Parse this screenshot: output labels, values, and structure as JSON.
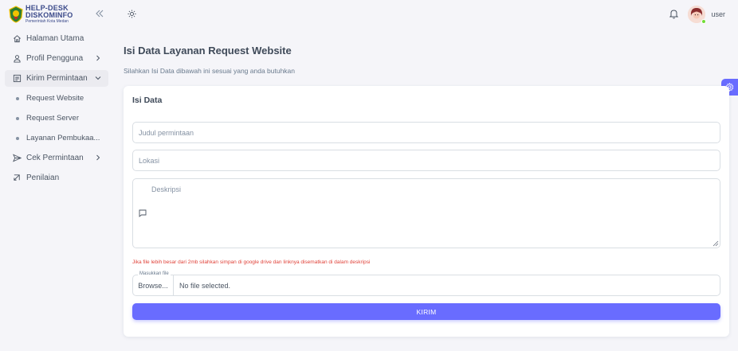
{
  "brand": {
    "line1": "HELP-DESK",
    "line2": "DISKOMINFO",
    "line3": "Pemerintah Kota Medan"
  },
  "sidebar": {
    "items": [
      {
        "label": "Halaman Utama",
        "icon": "home-icon"
      },
      {
        "label": "Profil Pengguna",
        "icon": "user-icon"
      },
      {
        "label": "Kirim Permintaan",
        "icon": "form-icon",
        "active": true,
        "children": [
          {
            "label": "Request Website"
          },
          {
            "label": "Request Server"
          },
          {
            "label": "Layanan Pembukaa..."
          }
        ]
      },
      {
        "label": "Cek Permintaan",
        "icon": "send-icon"
      },
      {
        "label": "Penilaian",
        "icon": "rating-icon"
      }
    ]
  },
  "header": {
    "username": "user"
  },
  "page": {
    "title": "Isi Data Layanan Request Website",
    "subtitle": "Silahkan Isi Data dibawah ini sesuai yang anda butuhkan"
  },
  "form": {
    "card_title": "Isi Data",
    "judul_placeholder": "Judul permintaan",
    "lokasi_placeholder": "Lokasi",
    "deskripsi_placeholder": "Deskripsi",
    "warning": "Jika file lebih besar dari 2mb silahkan simpan di google drive dan linknya disematkan di dalam deskripsi",
    "file_label": "Masukkan file",
    "browse_label": "Browse...",
    "file_status": "No file selected.",
    "submit_label": "KIRIM"
  },
  "colors": {
    "primary": "#696cff",
    "background": "#f5f5f9",
    "warning": "#e0433a"
  }
}
